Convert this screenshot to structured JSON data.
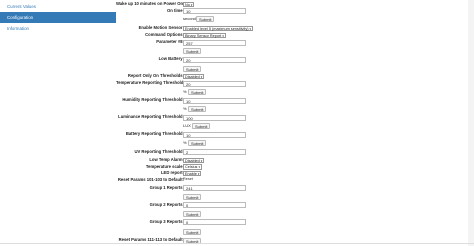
{
  "sidebar": {
    "items": [
      {
        "label": "Current Values"
      },
      {
        "label": "Configuration"
      },
      {
        "label": "Information"
      }
    ]
  },
  "form": {
    "wake_label": "Wake up 10 minutes on Power On:",
    "wake_value": "No",
    "ontime_label": "On time:",
    "ontime_value": "10",
    "ontime_unit": "seconds",
    "submit_label": "Submit",
    "motion_label": "Enable Motion Sensor:",
    "motion_value": "Enabled level 5 (maximum sensitivity)",
    "command_label": "Command Options:",
    "command_value": "Binary Sensor Report",
    "param8_label": "Parameter #8:",
    "param8_value": "257",
    "lowbat_label": "Low Battery:",
    "lowbat_value": "20",
    "report_thresh_label": "Report Only On Thresholds:",
    "report_thresh_value": "Disabled",
    "temp_thresh_label": "Temperature Reporting Threshold:",
    "temp_thresh_value": "20",
    "temp_thresh_unit": "%",
    "hum_thresh_label": "Humidity Reporting Threshold:",
    "hum_thresh_value": "10",
    "hum_thresh_unit": "%",
    "lum_thresh_label": "Luminance Reporting Threshold:",
    "lum_thresh_value": "100",
    "lum_thresh_unit": "LUX",
    "batt_thresh_label": "Battery Reporting Threshold:",
    "batt_thresh_value": "10",
    "batt_thresh_unit": "%",
    "uv_thresh_label": "UV Reporting Threshold:",
    "uv_thresh_value": "2",
    "lowtemp_label": "Low Temp Alarm:",
    "lowtemp_value": "Disabled",
    "tempscale_label": "Temperature scale:",
    "tempscale_value": "Celsius",
    "led_label": "LED report:",
    "led_value": "Enable",
    "reset1_label": "Reset Params 101-103 to Default:",
    "reset1_value": "Reset",
    "grp1_label": "Group 1 Reports:",
    "grp1_value": "241",
    "grp2_label": "Group 2 Reports:",
    "grp2_value": "0",
    "grp3_label": "Group 3 Reports:",
    "grp3_value": "0",
    "reset2_label": "Reset Params 111-113 to Default:"
  }
}
